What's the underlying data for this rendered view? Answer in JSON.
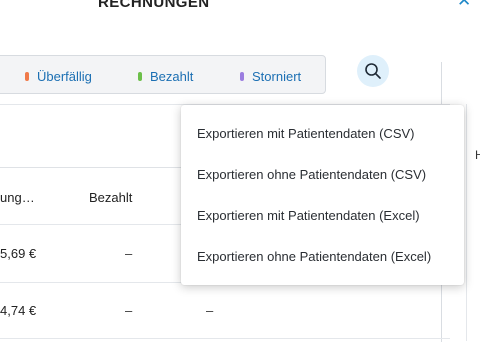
{
  "header": {
    "title": "RECHNUNGEN"
  },
  "filters": [
    {
      "label": "Überfällig",
      "color": "#f07a4a"
    },
    {
      "label": "Bezahlt",
      "color": "#6cbf4a"
    },
    {
      "label": "Storniert",
      "color": "#9b7de0"
    }
  ],
  "side": {
    "header_fragment": "H"
  },
  "table": {
    "headers": {
      "col1": "ung…",
      "col2": "Bezahlt"
    },
    "rows": [
      {
        "amount": "5,69 €",
        "paid": "–"
      },
      {
        "amount": "4,74 €",
        "paid": "–",
        "extra": "–"
      }
    ]
  },
  "export_menu": {
    "items": [
      "Exportieren mit Patientendaten (CSV)",
      "Exportieren ohne Patientendaten (CSV)",
      "Exportieren mit Patientendaten (Excel)",
      "Exportieren ohne Patientendaten (Excel)"
    ]
  },
  "colors": {
    "accent": "#1b6fb3",
    "search_bg": "#dff0fb"
  }
}
